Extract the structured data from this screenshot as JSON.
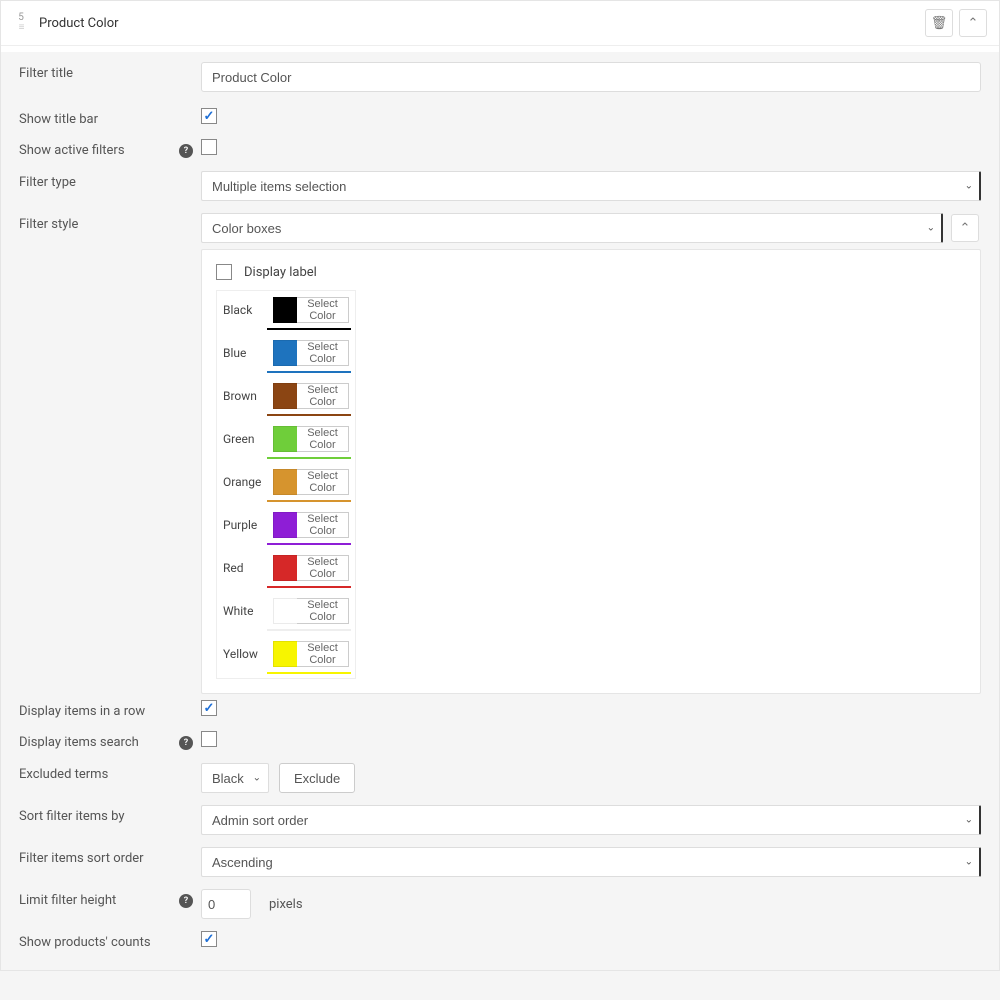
{
  "header": {
    "index": "5",
    "title": "Product Color"
  },
  "labels": {
    "filter_title": "Filter title",
    "show_title_bar": "Show title bar",
    "show_active_filters": "Show active filters",
    "filter_type": "Filter type",
    "filter_style": "Filter style",
    "display_label": "Display label",
    "display_items_row": "Display items in a row",
    "display_items_search": "Display items search",
    "excluded_terms": "Excluded terms",
    "sort_filter_items": "Sort filter items by",
    "filter_sort_order": "Filter items sort order",
    "limit_filter_height": "Limit filter height",
    "show_counts": "Show products' counts",
    "select_color": "Select Color",
    "exclude_btn": "Exclude",
    "pixels": "pixels"
  },
  "values": {
    "filter_title": "Product Color",
    "show_title_bar": true,
    "show_active_filters": false,
    "filter_type": "Multiple items selection",
    "filter_style": "Color boxes",
    "display_label": false,
    "display_items_row": true,
    "display_items_search": false,
    "excluded_term": "Black",
    "sort_by": "Admin sort order",
    "sort_order": "Ascending",
    "limit_height": "0",
    "show_counts": true
  },
  "colors": [
    {
      "name": "Black",
      "hex": "#000000"
    },
    {
      "name": "Blue",
      "hex": "#1e73be"
    },
    {
      "name": "Brown",
      "hex": "#8b4513"
    },
    {
      "name": "Green",
      "hex": "#6fce3a"
    },
    {
      "name": "Orange",
      "hex": "#d6942e"
    },
    {
      "name": "Purple",
      "hex": "#8e1ed6"
    },
    {
      "name": "Red",
      "hex": "#d62828"
    },
    {
      "name": "White",
      "hex": "#ffffff"
    },
    {
      "name": "Yellow",
      "hex": "#f7f500"
    }
  ]
}
